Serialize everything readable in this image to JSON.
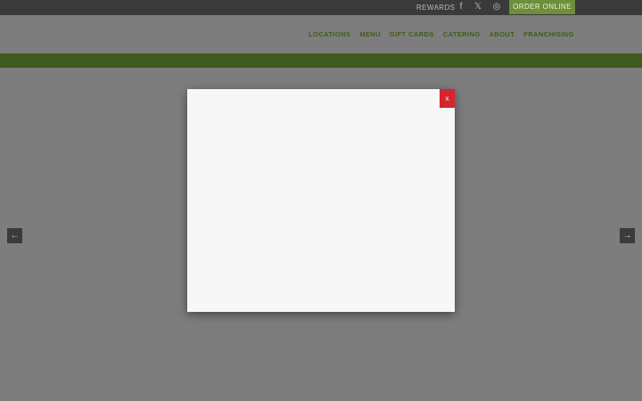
{
  "topbar": {
    "rewards_label": "REWARDS",
    "order_label": "ORDER ONLINE",
    "social": [
      {
        "name": "facebook-icon",
        "glyph": "f"
      },
      {
        "name": "x-twitter-icon",
        "glyph": "𝕏"
      },
      {
        "name": "instagram-icon",
        "glyph": "◎"
      }
    ]
  },
  "nav": {
    "items": [
      "LOCATIONS",
      "MENU",
      "GIFT CARDS",
      "CATERING",
      "ABOUT",
      "FRANCHISING"
    ]
  },
  "slider": {
    "prev_icon": "←",
    "next_icon": "→"
  },
  "modal": {
    "close_label": "x"
  },
  "colors": {
    "brand_green": "#6d8f3a",
    "close_red": "#d7252f",
    "overlay": "#7d7d7d"
  }
}
